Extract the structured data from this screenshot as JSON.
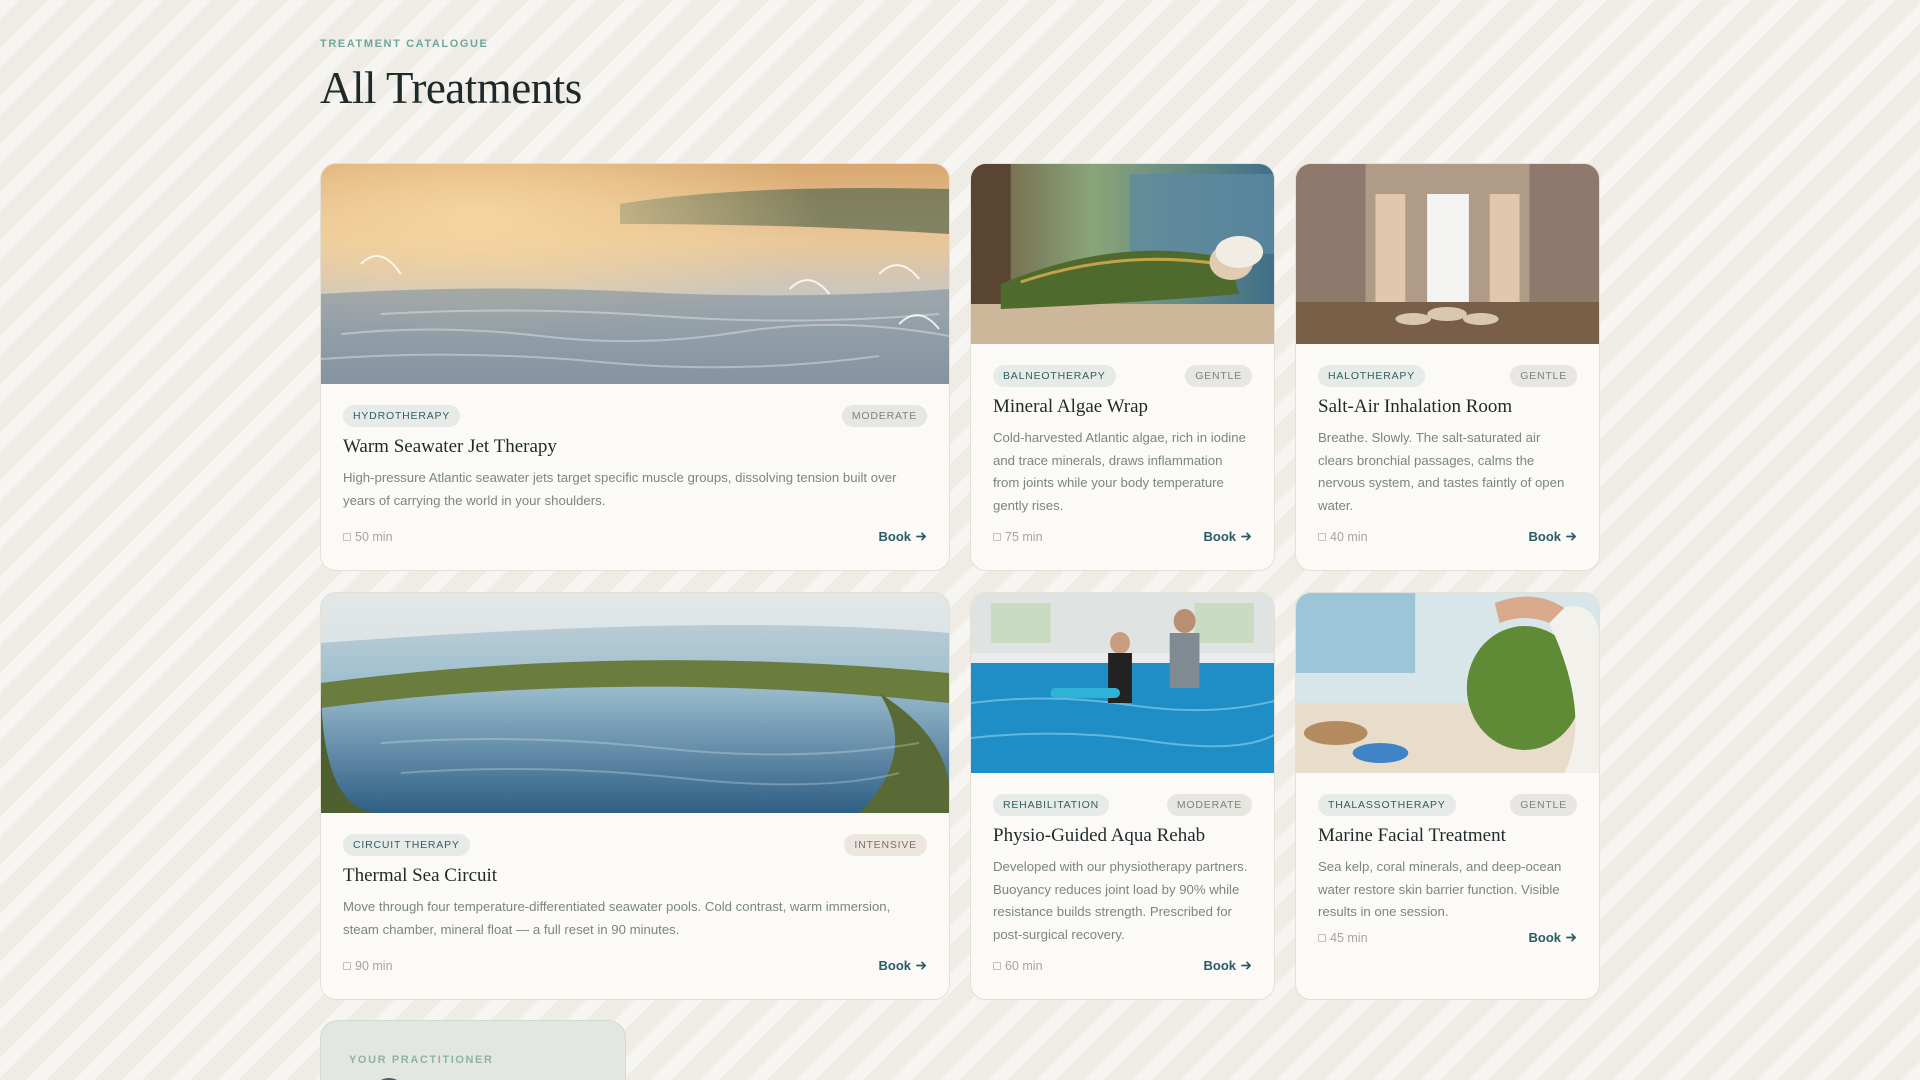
{
  "header": {
    "eyebrow": "TREATMENT CATALOGUE",
    "title": "All Treatments"
  },
  "cards": [
    {
      "category": "HYDROTHERAPY",
      "intensity": "MODERATE",
      "title": "Warm Seawater Jet Therapy",
      "description": "High-pressure Atlantic seawater jets target specific muscle groups, dissolving tension built over years of carrying the world in your shoulders.",
      "duration": "50 min",
      "book_label": "Book",
      "image": "misty seawater pool at sunset with water jets"
    },
    {
      "category": "BALNEOTHERAPY",
      "intensity": "GENTLE",
      "title": "Mineral Algae Wrap",
      "description": "Cold-harvested Atlantic algae, rich in iodine and trace minerals, draws inflammation from joints while your body temperature gently rises.",
      "duration": "75 min",
      "book_label": "Book",
      "image": "woman wrapped in seaweed on treatment bed by the sea"
    },
    {
      "category": "HALOTHERAPY",
      "intensity": "GENTLE",
      "title": "Salt-Air Inhalation Room",
      "description": "Breathe. Slowly. The salt-saturated air clears bronchial passages, calms the nervous system, and tastes faintly of open water.",
      "duration": "40 min",
      "book_label": "Book",
      "image": "salt brick room with bowls of salt"
    },
    {
      "category": "CIRCUIT THERAPY",
      "intensity": "INTENSIVE",
      "title": "Thermal Sea Circuit",
      "description": "Move through four temperature-differentiated seawater pools. Cold contrast, warm immersion, steam chamber, mineral float — a full reset in 90 minutes.",
      "duration": "90 min",
      "book_label": "Book",
      "image": "steaming terraced thermal sea pools"
    },
    {
      "category": "REHABILITATION",
      "intensity": "MODERATE",
      "title": "Physio-Guided Aqua Rehab",
      "description": "Developed with our physiotherapy partners. Buoyancy reduces joint load by 90% while resistance builds strength. Prescribed for post-surgical recovery.",
      "duration": "60 min",
      "book_label": "Book",
      "image": "physiotherapist guiding woman in pool"
    },
    {
      "category": "THALASSOTHERAPY",
      "intensity": "GENTLE",
      "title": "Marine Facial Treatment",
      "description": "Sea kelp, coral minerals, and deep-ocean water restore skin barrier function. Visible results in one session.",
      "duration": "45 min",
      "book_label": "Book",
      "image": "woman with green seaweed face mask"
    }
  ],
  "practitioner": {
    "label": "YOUR PRACTITIONER"
  },
  "colors": {
    "accent": "#6ea89a",
    "book_link": "#2a5c66",
    "tag_bg": "#e6ebe7",
    "background": "#efece6"
  }
}
